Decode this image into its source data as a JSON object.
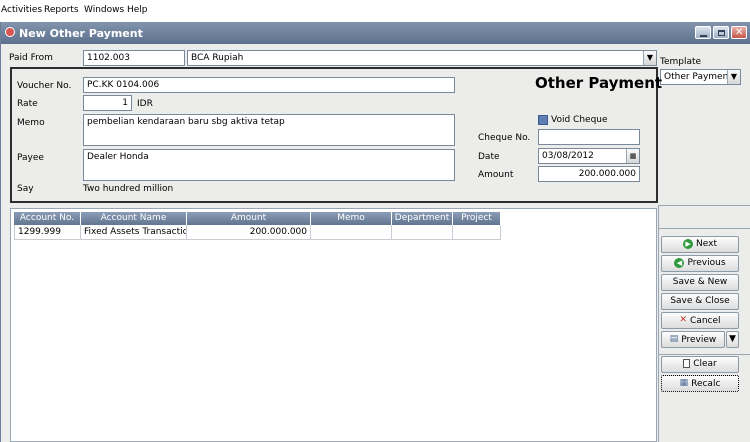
{
  "menu": [
    "Activities",
    "Reports",
    "Windows",
    "Help"
  ],
  "window": {
    "title": "New Other Payment"
  },
  "paid_from": {
    "label": "Paid From",
    "account_no": "1102.003",
    "account_name": "BCA Rupiah"
  },
  "template": {
    "label": "Template",
    "value": "Other Payment"
  },
  "form": {
    "heading": "Other Payment",
    "voucher_label": "Voucher No.",
    "voucher_value": "PC.KK 0104.006",
    "rate_label": "Rate",
    "rate_value": "1",
    "rate_currency": "IDR",
    "memo_label": "Memo",
    "memo_value": "pembelian kendaraan baru sbg aktiva tetap",
    "payee_label": "Payee",
    "payee_value": "Dealer Honda",
    "say_label": "Say",
    "say_value": "Two hundred million",
    "void_cheque_label": "Void Cheque",
    "cheque_no_label": "Cheque No.",
    "cheque_no_value": "",
    "date_label": "Date",
    "date_value": "03/08/2012",
    "amount_label": "Amount",
    "amount_value": "200.000.000"
  },
  "table": {
    "columns": [
      "Account No.",
      "Account Name",
      "Amount",
      "Memo",
      "Department",
      "Project"
    ],
    "rows": [
      [
        "1299.999",
        "Fixed Assets Transaction",
        "200.000.000",
        "",
        "",
        ""
      ]
    ]
  },
  "buttons": {
    "next": "Next",
    "previous": "Previous",
    "save_new": "Save & New",
    "save_close": "Save & Close",
    "cancel": "Cancel",
    "preview": "Preview",
    "clear": "Clear",
    "recalc": "Recalc"
  }
}
